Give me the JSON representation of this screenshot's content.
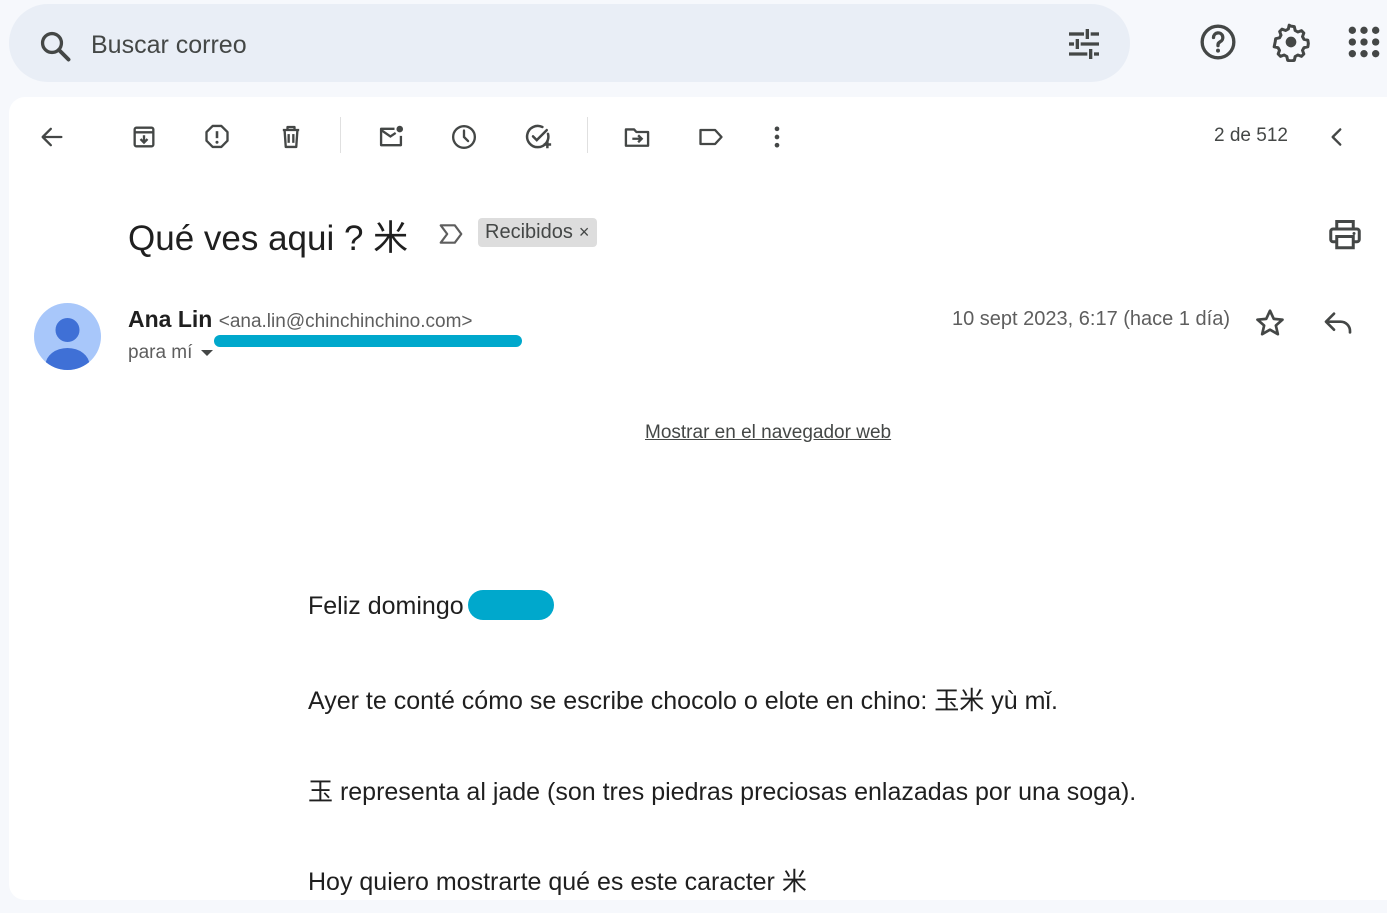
{
  "search": {
    "placeholder": "Buscar correo"
  },
  "toolbar": {
    "pager": "2 de 512"
  },
  "email": {
    "subject": "Qué ves aqui ? 米",
    "label": "Recibidos",
    "label_close": "×",
    "sender_name": "Ana Lin",
    "sender_email": "<ana.lin@chinchinchino.com>",
    "recipient": "para mí",
    "date": "10 sept 2023, 6:17 (hace 1 día)",
    "web_link": "Mostrar en el navegador web",
    "body": [
      "Feliz domingo",
      "Ayer te conté cómo se escribe chocolo o elote en chino: 玉米 yù mǐ.",
      "玉 representa al jade (son tres piedras preciosas enlazadas por una soga).",
      "Hoy quiero mostrarte qué es este caracter 米"
    ]
  },
  "colors": {
    "accent_redaction": "#00a8cc",
    "avatar_bg": "#a8c7fa",
    "avatar_fg": "#3f70d6"
  }
}
